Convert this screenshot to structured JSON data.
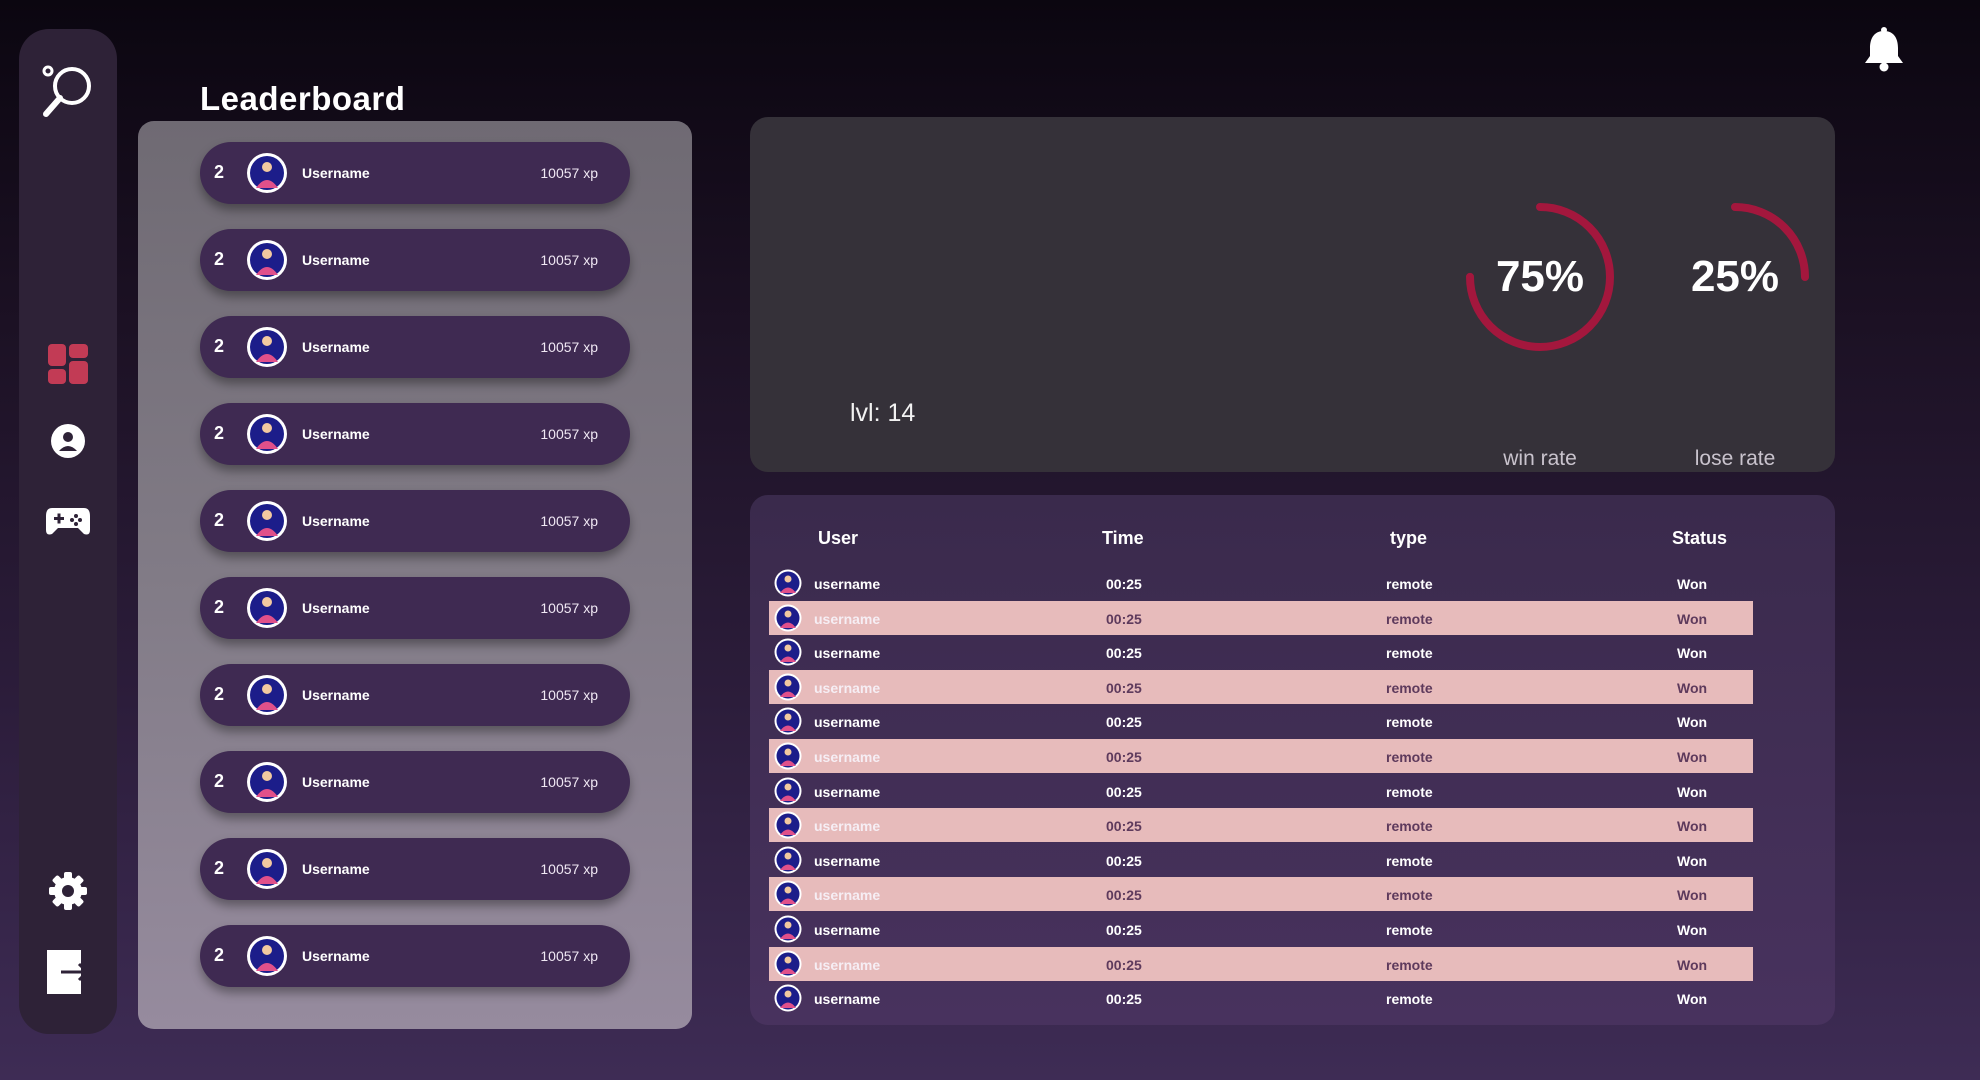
{
  "header": {
    "title": "Leaderboard"
  },
  "sidebar": {
    "items": [
      {
        "icon": "ping-pong-logo-icon"
      },
      {
        "icon": "dashboard-icon"
      },
      {
        "icon": "profile-icon"
      },
      {
        "icon": "gamepad-icon"
      },
      {
        "icon": "settings-icon"
      },
      {
        "icon": "logout-icon"
      }
    ]
  },
  "leaderboard": {
    "items": [
      {
        "rank": "2",
        "name": "Username",
        "xp": "10057 xp"
      },
      {
        "rank": "2",
        "name": "Username",
        "xp": "10057 xp"
      },
      {
        "rank": "2",
        "name": "Username",
        "xp": "10057 xp"
      },
      {
        "rank": "2",
        "name": "Username",
        "xp": "10057 xp"
      },
      {
        "rank": "2",
        "name": "Username",
        "xp": "10057 xp"
      },
      {
        "rank": "2",
        "name": "Username",
        "xp": "10057 xp"
      },
      {
        "rank": "2",
        "name": "Username",
        "xp": "10057 xp"
      },
      {
        "rank": "2",
        "name": "Username",
        "xp": "10057 xp"
      },
      {
        "rank": "2",
        "name": "Username",
        "xp": "10057 xp"
      },
      {
        "rank": "2",
        "name": "Username",
        "xp": "10057 xp"
      }
    ]
  },
  "stats": {
    "level": "lvl: 14",
    "win": {
      "value": "75%",
      "label": "win rate",
      "fraction": 0.75
    },
    "lose": {
      "value": "25%",
      "label": "lose rate",
      "fraction": 0.25
    },
    "accent": "#a3173d"
  },
  "history": {
    "headers": {
      "user": "User",
      "time": "Time",
      "type": "type",
      "status": "Status"
    },
    "rows": [
      {
        "user": "username",
        "time": "00:25",
        "type": "remote",
        "status": "Won"
      },
      {
        "user": "username",
        "time": "00:25",
        "type": "remote",
        "status": "Won"
      },
      {
        "user": "username",
        "time": "00:25",
        "type": "remote",
        "status": "Won"
      },
      {
        "user": "username",
        "time": "00:25",
        "type": "remote",
        "status": "Won"
      },
      {
        "user": "username",
        "time": "00:25",
        "type": "remote",
        "status": "Won"
      },
      {
        "user": "username",
        "time": "00:25",
        "type": "remote",
        "status": "Won"
      },
      {
        "user": "username",
        "time": "00:25",
        "type": "remote",
        "status": "Won"
      },
      {
        "user": "username",
        "time": "00:25",
        "type": "remote",
        "status": "Won"
      },
      {
        "user": "username",
        "time": "00:25",
        "type": "remote",
        "status": "Won"
      },
      {
        "user": "username",
        "time": "00:25",
        "type": "remote",
        "status": "Won"
      },
      {
        "user": "username",
        "time": "00:25",
        "type": "remote",
        "status": "Won"
      },
      {
        "user": "username",
        "time": "00:25",
        "type": "remote",
        "status": "Won"
      },
      {
        "user": "username",
        "time": "00:25",
        "type": "remote",
        "status": "Won"
      }
    ]
  }
}
